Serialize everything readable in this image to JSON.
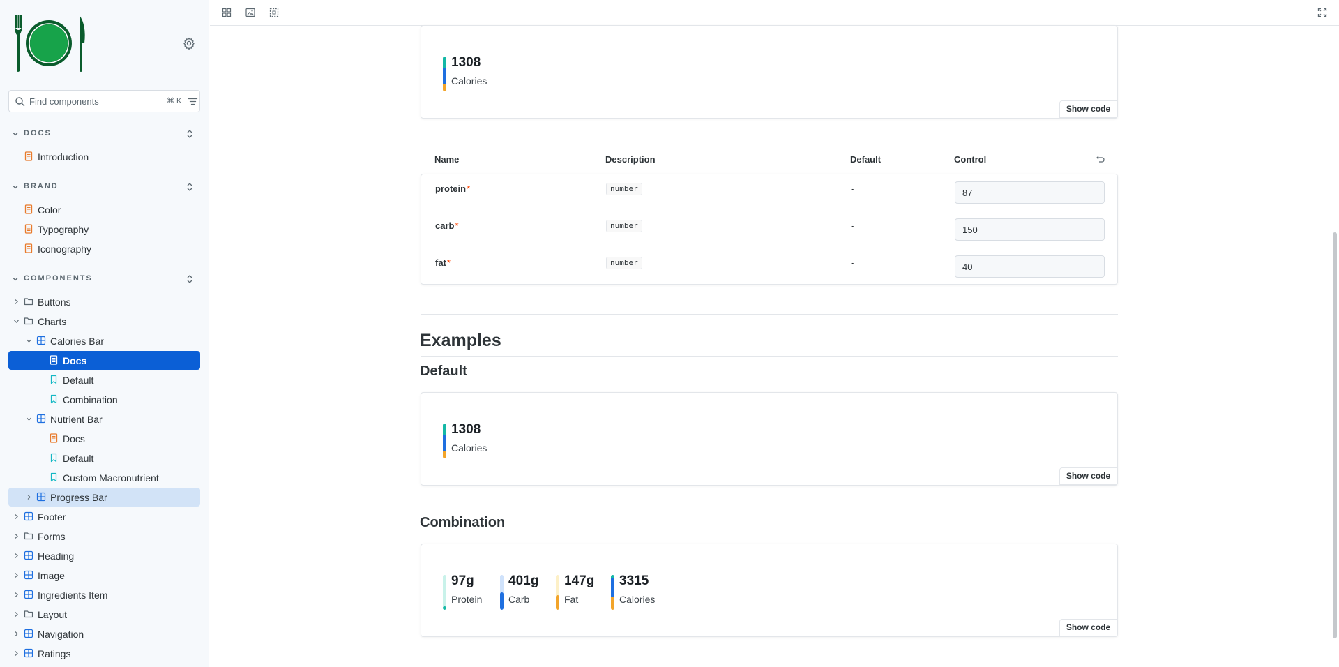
{
  "sidebar": {
    "search": {
      "placeholder": "Find components",
      "shortcut": "⌘ K"
    },
    "docs_group": {
      "label": "DOCS",
      "items": [
        {
          "label": "Introduction"
        }
      ]
    },
    "brand_group": {
      "label": "BRAND",
      "items": [
        {
          "label": "Color"
        },
        {
          "label": "Typography"
        },
        {
          "label": "Iconography"
        }
      ]
    },
    "components_group": {
      "label": "COMPONENTS",
      "items": [
        {
          "label": "Buttons"
        },
        {
          "label": "Charts"
        },
        {
          "label": "Calories Bar"
        },
        {
          "label": "Docs"
        },
        {
          "label": "Default"
        },
        {
          "label": "Combination"
        },
        {
          "label": "Nutrient Bar"
        },
        {
          "label": "Docs"
        },
        {
          "label": "Default"
        },
        {
          "label": "Custom Macronutrient"
        },
        {
          "label": "Progress Bar"
        },
        {
          "label": "Footer"
        },
        {
          "label": "Forms"
        },
        {
          "label": "Heading"
        },
        {
          "label": "Image"
        },
        {
          "label": "Ingredients Item"
        },
        {
          "label": "Layout"
        },
        {
          "label": "Navigation"
        },
        {
          "label": "Ratings"
        }
      ]
    }
  },
  "primary_preview": {
    "value": "1308",
    "label": "Calories",
    "show_code": "Show code"
  },
  "args_table": {
    "headers": {
      "name": "Name",
      "description": "Description",
      "default": "Default",
      "control": "Control"
    },
    "rows": [
      {
        "name": "protein",
        "required": "*",
        "type": "number",
        "default": "-",
        "value": "87"
      },
      {
        "name": "carb",
        "required": "*",
        "type": "number",
        "default": "-",
        "value": "150"
      },
      {
        "name": "fat",
        "required": "*",
        "type": "number",
        "default": "-",
        "value": "40"
      }
    ]
  },
  "examples": {
    "heading": "Examples",
    "default": {
      "heading": "Default",
      "value": "1308",
      "label": "Calories",
      "show_code": "Show code"
    },
    "combination": {
      "heading": "Combination",
      "show_code": "Show code",
      "stats": [
        {
          "value": "97g",
          "label": "Protein"
        },
        {
          "value": "401g",
          "label": "Carb"
        },
        {
          "value": "147g",
          "label": "Fat"
        },
        {
          "value": "3315",
          "label": "Calories"
        }
      ]
    }
  },
  "colors": {
    "protein": "#14b8a6",
    "carb": "#1e6fe0",
    "fat": "#f2a42a",
    "selected_nav": "#0b5fd6",
    "hover_nav": "#d2e3f7",
    "logo": "#0a5c2c",
    "logo_plate": "#17a34a"
  }
}
